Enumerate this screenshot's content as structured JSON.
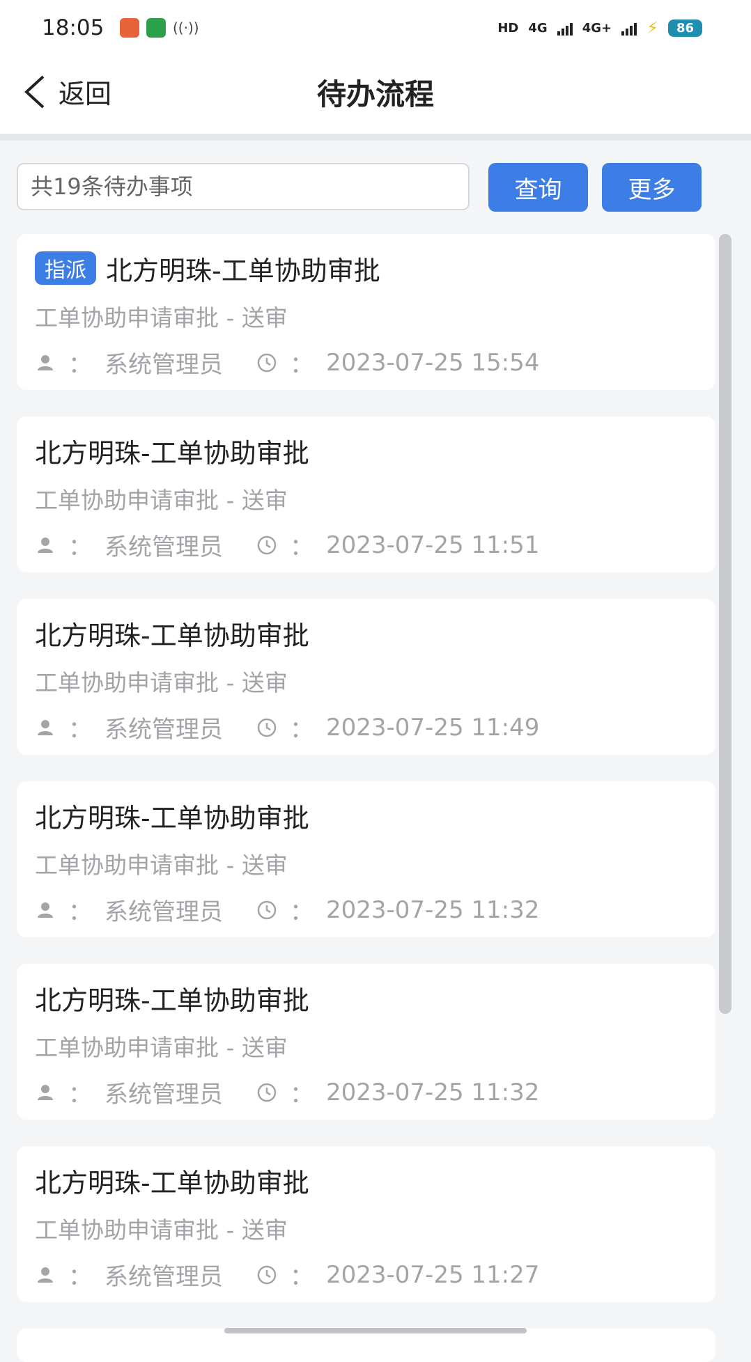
{
  "status_bar": {
    "time": "18:05",
    "network1": "4G",
    "network2": "4G+",
    "hd": "HD",
    "battery": "86"
  },
  "nav": {
    "back_label": "返回",
    "title": "待办流程"
  },
  "search": {
    "placeholder": "共19条待办事项",
    "query_label": "查询",
    "more_label": "更多"
  },
  "items": [
    {
      "tag": "指派",
      "title": "北方明珠-工单协助审批",
      "subtitle": "工单协助申请审批 - 送审",
      "user": "系统管理员",
      "time": "2023-07-25 15:54"
    },
    {
      "tag": "",
      "title": "北方明珠-工单协助审批",
      "subtitle": "工单协助申请审批 - 送审",
      "user": "系统管理员",
      "time": "2023-07-25 11:51"
    },
    {
      "tag": "",
      "title": "北方明珠-工单协助审批",
      "subtitle": "工单协助申请审批 - 送审",
      "user": "系统管理员",
      "time": "2023-07-25 11:49"
    },
    {
      "tag": "",
      "title": "北方明珠-工单协助审批",
      "subtitle": "工单协助申请审批 - 送审",
      "user": "系统管理员",
      "time": "2023-07-25 11:32"
    },
    {
      "tag": "",
      "title": "北方明珠-工单协助审批",
      "subtitle": "工单协助申请审批 - 送审",
      "user": "系统管理员",
      "time": "2023-07-25 11:32"
    },
    {
      "tag": "",
      "title": "北方明珠-工单协助审批",
      "subtitle": "工单协助申请审批 - 送审",
      "user": "系统管理员",
      "time": "2023-07-25 11:27"
    }
  ],
  "meta_separator": "：",
  "colors": {
    "accent": "#3d7ee6",
    "muted_text": "#a2a4a8",
    "page_bg": "#f4f5f7"
  }
}
